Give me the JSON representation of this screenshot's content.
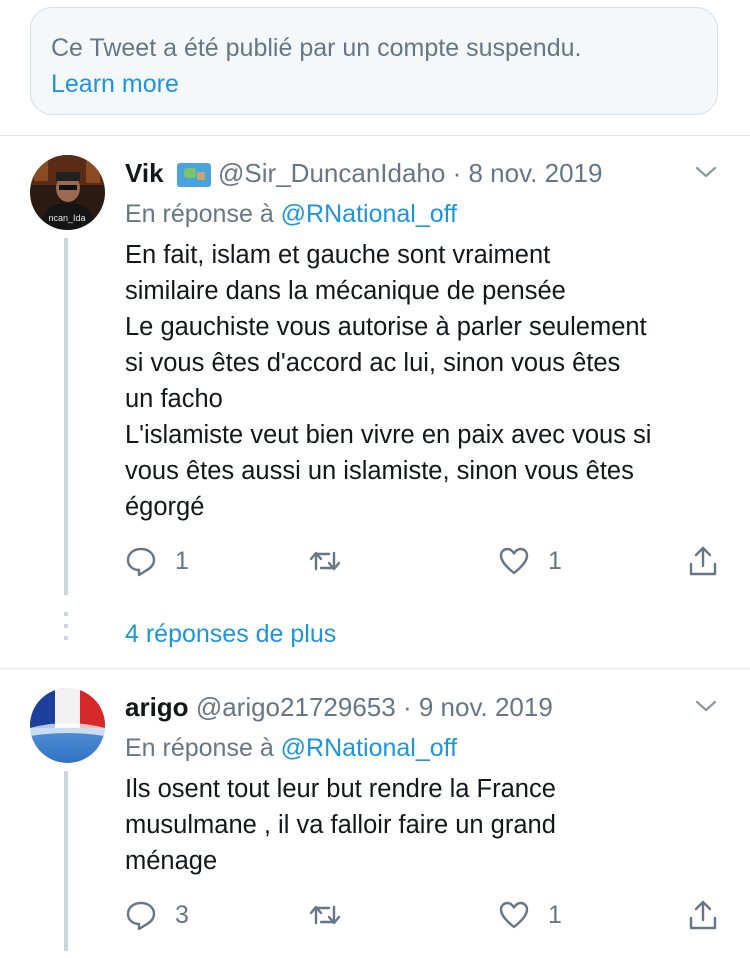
{
  "notice": {
    "text": "Ce Tweet a été publié par un compte suspendu.",
    "link": "Learn more"
  },
  "tweets": [
    {
      "name": "Vik",
      "emoji": "map-emoji",
      "handle": "@Sir_DuncanIdaho",
      "dot": "·",
      "date": "8 nov. 2019",
      "reply_prefix": "En réponse à",
      "reply_mention": "@RNational_off",
      "avatar_text": "ncan_Ida",
      "body": "En fait, islam et gauche sont vraiment\nsimilaire dans la mécanique de pensée\nLe gauchiste vous autorise à parler seulement\nsi vous êtes d'accord ac lui, sinon vous êtes\nun facho\nL'islamiste veut bien vivre en paix avec vous si\nvous êtes aussi un islamiste, sinon vous êtes\négorgé",
      "replies": "1",
      "retweets": "",
      "likes": "1"
    },
    {
      "name": "arigo",
      "handle": "@arigo21729653",
      "dot": "·",
      "date": "9 nov. 2019",
      "reply_prefix": "En réponse à",
      "reply_mention": "@RNational_off",
      "body": "Ils osent tout leur but rendre la France\nmusulmane ,  il va falloir faire un grand\nménage",
      "replies": "3",
      "retweets": "",
      "likes": "1"
    }
  ],
  "more_replies": "4 réponses de plus",
  "colors": {
    "link": "#1b95e0",
    "muted": "#657786",
    "line": "#ccd6dd",
    "sep": "#e1e8ed"
  }
}
